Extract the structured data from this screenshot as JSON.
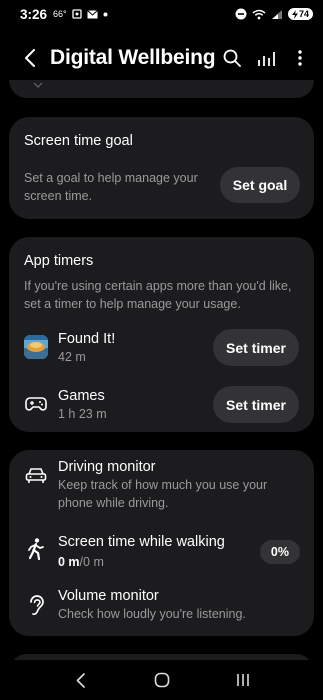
{
  "status": {
    "time": "3:26",
    "temp": "66°",
    "battery": "74"
  },
  "header": {
    "title": "Digital Wellbeing"
  },
  "screen_time_goal": {
    "title": "Screen time goal",
    "subtitle": "Set a goal to help manage your screen time.",
    "button": "Set goal"
  },
  "app_timers": {
    "title": "App timers",
    "subtitle": "If you're using certain apps more than you'd like, set a timer to help manage your usage.",
    "apps": [
      {
        "name": "Found It!",
        "time": "42 m",
        "button": "Set timer",
        "icon": "found-it-app-icon"
      },
      {
        "name": "Games",
        "time": "1 h 23 m",
        "button": "Set timer",
        "icon": "gamepad-icon"
      }
    ]
  },
  "monitors": {
    "driving": {
      "title": "Driving monitor",
      "subtitle": "Keep track of how much you use your phone while driving.",
      "icon": "car-icon"
    },
    "walking": {
      "title": "Screen time while walking",
      "value_bold": "0 m",
      "value_rest": "/0 m",
      "percent": "0%",
      "icon": "walking-icon"
    },
    "volume": {
      "title": "Volume monitor",
      "subtitle": "Check how loudly you're listening.",
      "icon": "ear-icon"
    }
  }
}
